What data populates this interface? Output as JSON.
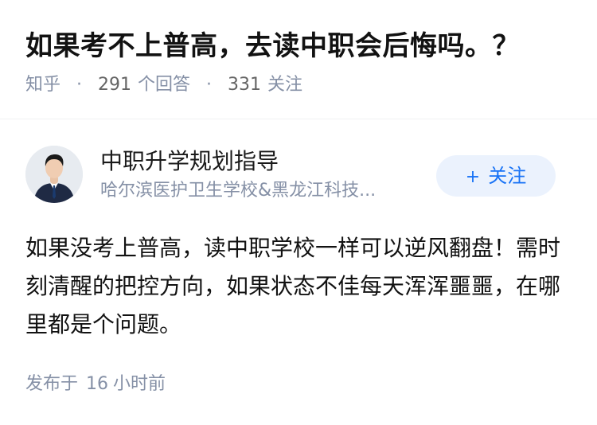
{
  "question": {
    "title": "如果考不上普高，去读中职会后悔吗。？",
    "source": "知乎",
    "answer_count": "291",
    "answer_label": "个回答",
    "follower_count": "331",
    "follower_label": "关注"
  },
  "author": {
    "name": "中职升学规划指导",
    "bio": "哈尔滨医护卫生学校&黑龙江科技...",
    "avatar_icon": "person-avatar",
    "follow_label": "关注",
    "follow_icon": "plus-icon",
    "accent_color": "#1772f6",
    "button_bg": "#ebf2fd"
  },
  "answer": {
    "content": "如果没考上普高，读中职学校一样可以逆风翻盘！需时刻清醒的把控方向，如果状态不佳每天浑浑噩噩，在哪里都是个问题。",
    "published_prefix": "发布于",
    "published_num": "16",
    "published_unit": "小时前"
  }
}
